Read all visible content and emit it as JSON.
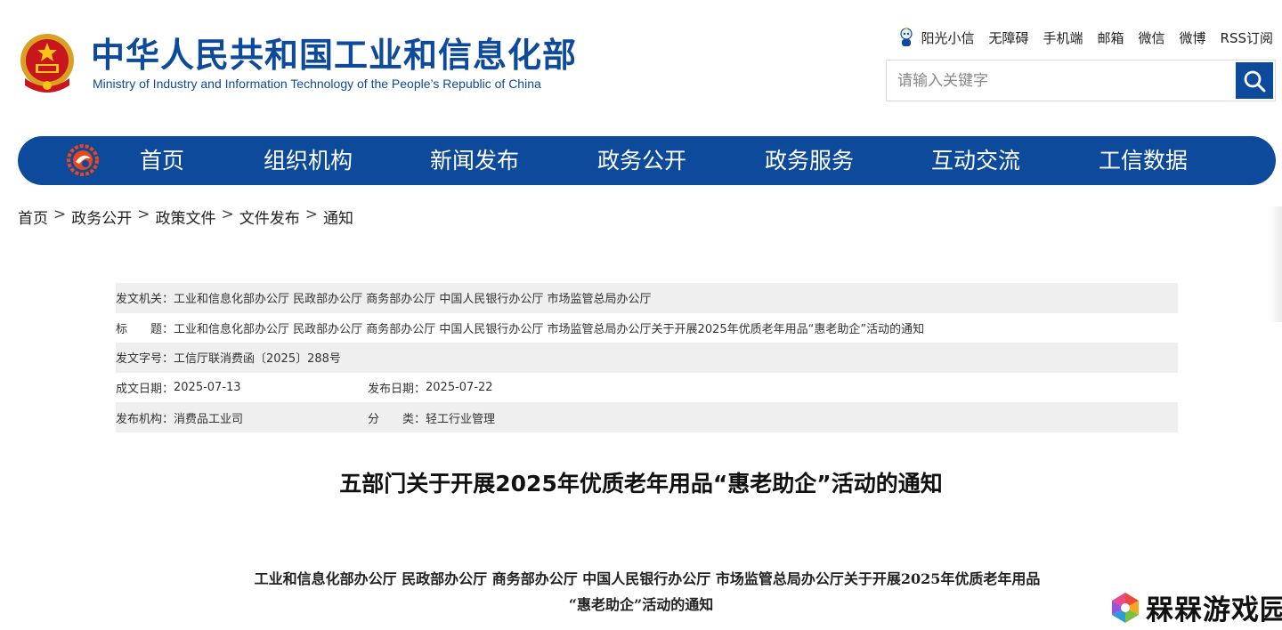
{
  "header": {
    "title_cn": "中华人民共和国工业和信息化部",
    "title_en": "Ministry of Industry and Information Technology of the People’s Republic of China",
    "emblem_icon": "national-emblem-icon",
    "accent_color": "#0d4a9b"
  },
  "top_links": [
    {
      "label": "阳光小信",
      "icon": "mascot-icon"
    },
    {
      "label": "无障碍"
    },
    {
      "label": "手机端"
    },
    {
      "label": "邮箱"
    },
    {
      "label": "微信"
    },
    {
      "label": "微博"
    },
    {
      "label": "RSS订阅"
    }
  ],
  "search": {
    "placeholder": "请输入关键字",
    "button_icon": "search-icon"
  },
  "nav": {
    "logo_icon": "miit-logo-icon",
    "items": [
      {
        "label": "首页"
      },
      {
        "label": "组织机构"
      },
      {
        "label": "新闻发布"
      },
      {
        "label": "政务公开"
      },
      {
        "label": "政务服务"
      },
      {
        "label": "互动交流"
      },
      {
        "label": "工信数据"
      }
    ]
  },
  "breadcrumb": {
    "items": [
      "首页",
      "政务公开",
      "政策文件",
      "文件发布",
      "通知"
    ],
    "separator": ">"
  },
  "meta": {
    "issuer_label": "发文机关：",
    "issuer_value": "工业和信息化部办公厅 民政部办公厅 商务部办公厅 中国人民银行办公厅 市场监管总局办公厅",
    "title_label": "标　　题：",
    "title_value": "工业和信息化部办公厅 民政部办公厅 商务部办公厅 中国人民银行办公厅 市场监管总局办公厅关于开展2025年优质老年用品“惠老助企”活动的通知",
    "doc_no_label": "发文字号：",
    "doc_no_value": "工信厅联消费函〔2025〕288号",
    "written_label": "成文日期：",
    "written_value": "2025-07-13",
    "published_label": "发布日期：",
    "published_value": "2025-07-22",
    "org_label": "发布机构：",
    "org_value": "消费品工业司",
    "category_label": "分　　类：",
    "category_value": "轻工行业管理"
  },
  "document": {
    "title": "五部门关于开展2025年优质老年用品“惠老助企”活动的通知",
    "body_heading_line1": "工业和信息化部办公厅  民政部办公厅  商务部办公厅  中国人民银行办公厅  市场监管总局办公厅关于开展2025年优质老年用品",
    "body_heading_line2": "“惠老助企”活动的通知"
  },
  "watermark": {
    "text": "槑槑游戏园",
    "icon": "watermark-logo-icon"
  }
}
